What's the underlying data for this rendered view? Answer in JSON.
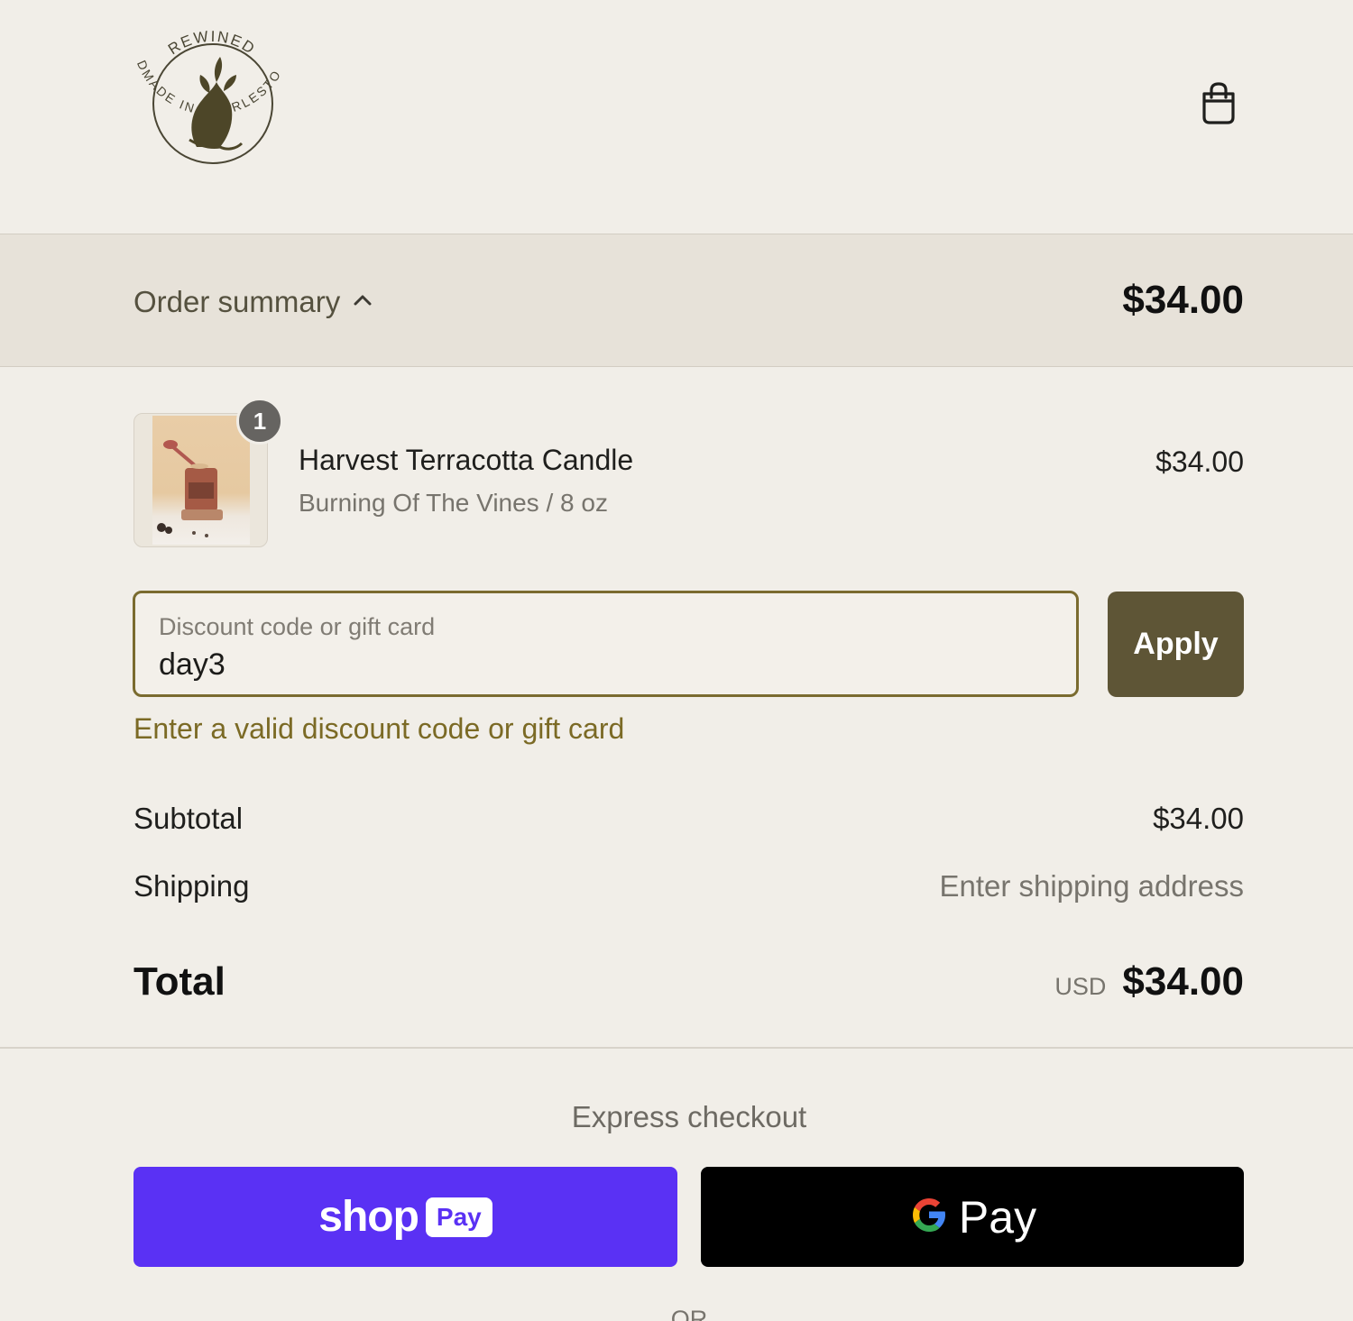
{
  "brand": {
    "name": "REWINED",
    "tagline": "HANDMADE IN CHARLESTON SC"
  },
  "header": {
    "cart_icon": "shopping-bag-icon"
  },
  "order_summary": {
    "label": "Order summary",
    "toggle_icon": "chevron-up-icon",
    "total": "$34.00"
  },
  "line_item": {
    "quantity": "1",
    "name": "Harvest Terracotta Candle",
    "variant": "Burning Of The Vines / 8 oz",
    "price": "$34.00"
  },
  "discount": {
    "label": "Discount code or gift card",
    "value": "day3",
    "apply_label": "Apply",
    "error": "Enter a valid discount code or gift card"
  },
  "totals": {
    "subtotal_label": "Subtotal",
    "subtotal_value": "$34.00",
    "shipping_label": "Shipping",
    "shipping_value": "Enter shipping address",
    "total_label": "Total",
    "currency": "USD",
    "total_value": "$34.00"
  },
  "express": {
    "title": "Express checkout",
    "shop_pay_word": "shop",
    "shop_pay_chip": "Pay",
    "gpay_word": "Pay",
    "or": "OR"
  },
  "colors": {
    "background": "#f1eee8",
    "summary_bar": "#e7e2d9",
    "accent": "#5e5536",
    "error": "#7b6a25",
    "shop_pay": "#5a31f4",
    "gpay": "#000000"
  }
}
